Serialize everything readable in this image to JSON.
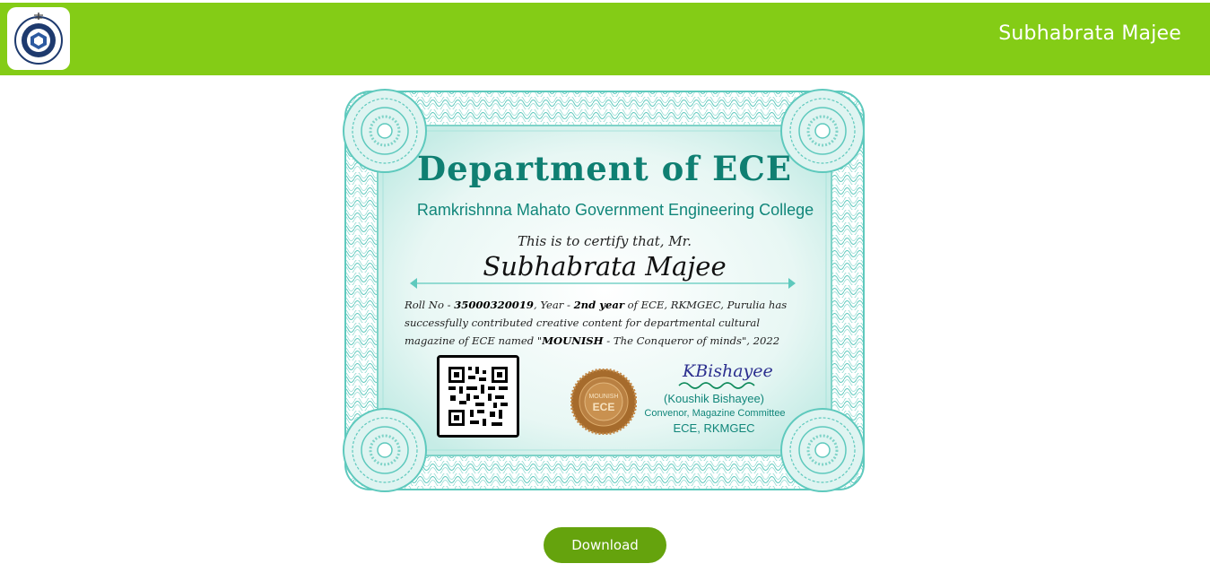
{
  "header": {
    "user_name": "Subhabrata Majee",
    "bar_color": "#84cc16",
    "logo_icon": "college-emblem-icon"
  },
  "certificate": {
    "department_title": "Department of ECE",
    "college_name": "Ramkrishnna Mahato Government Engineering College",
    "certify_line": "This is to certify that, Mr.",
    "recipient_name": "Subhabrata Majee",
    "body": {
      "roll_prefix": "Roll No - ",
      "roll_no": "35000320019",
      "year_prefix": ", Year - ",
      "year": "2nd year",
      "line_rest": " of ECE, RKMGEC, Purulia has successfully contributed creative content for departmental cultural magazine of ECE named \"",
      "magazine": "MOUNISH",
      "tail": " - The Conqueror of minds\", 2022"
    },
    "seal": {
      "top_text": "MOUNISH",
      "main_text": "ECE",
      "ring_text": "Government Engineering"
    },
    "signature": {
      "script": "KBishayee",
      "name": "(Koushik Bishayee)",
      "role": "Convenor, Magazine Committee",
      "dept": "ECE, RKMGEC"
    },
    "accent_color": "#0f7f72",
    "frame_color": "#5ec9bd"
  },
  "actions": {
    "download_label": "Download",
    "button_color": "#65a30d"
  }
}
